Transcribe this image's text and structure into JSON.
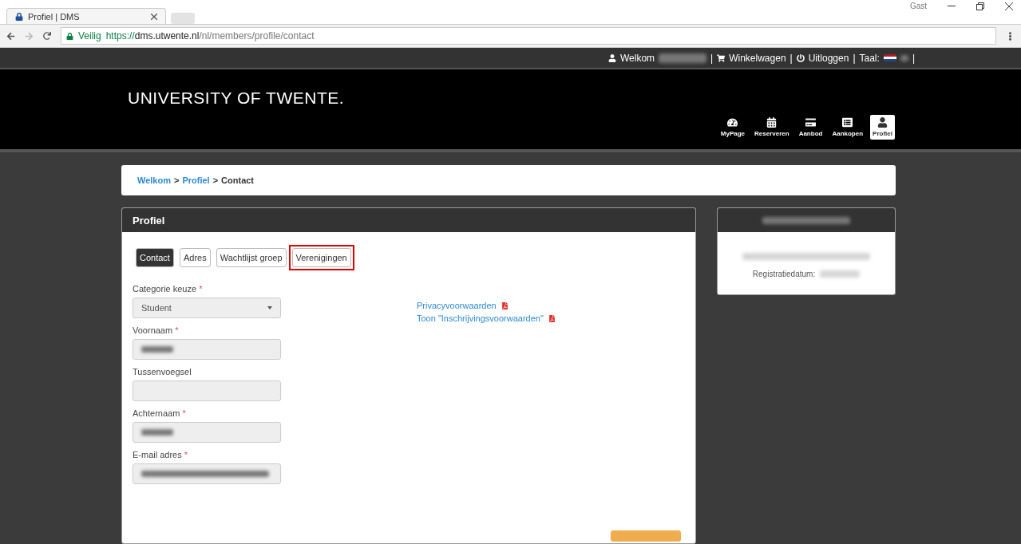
{
  "browser": {
    "tab_title": "Profiel | DMS",
    "window_user": "Gast",
    "secure_label": "Veilig",
    "url_scheme": "https://",
    "url_host": "dms.utwente.nl",
    "url_path": "/nl/members/profile/contact"
  },
  "top_bar": {
    "welcome": "Welkom",
    "cart": "Winkelwagen",
    "logout": "Uitloggen",
    "language_label": "Taal:",
    "separators": [
      "|",
      "|",
      "|",
      "|"
    ]
  },
  "header": {
    "logo": "UNIVERSITY OF TWENTE.",
    "nav": [
      {
        "label": "MyPage",
        "selected": false
      },
      {
        "label": "Reserveren",
        "selected": false
      },
      {
        "label": "Aanbod",
        "selected": false
      },
      {
        "label": "Aankopen",
        "selected": false
      },
      {
        "label": "Profiel",
        "selected": true
      }
    ]
  },
  "breadcrumb": [
    {
      "label": "Welkom",
      "link": true
    },
    {
      "label": ">",
      "link": false
    },
    {
      "label": "Profiel",
      "link": true
    },
    {
      "label": ">",
      "link": false
    },
    {
      "label": "Contact",
      "link": false
    }
  ],
  "panel": {
    "title": "Profiel",
    "tabs": [
      {
        "label": "Contact",
        "selected": true,
        "highlighted": false
      },
      {
        "label": "Adres",
        "selected": false,
        "highlighted": false
      },
      {
        "label": "Wachtlijst groep",
        "selected": false,
        "highlighted": false
      },
      {
        "label": "Verenigingen",
        "selected": false,
        "highlighted": true
      }
    ],
    "fields": [
      {
        "kind": "select",
        "label": "Categorie keuze",
        "required": true,
        "value": "Student"
      },
      {
        "kind": "input",
        "label": "Voornaam",
        "required": true,
        "value_hidden": true
      },
      {
        "kind": "input",
        "label": "Tussenvoegsel",
        "required": false,
        "value_hidden": false
      },
      {
        "kind": "input",
        "label": "Achternaam",
        "required": true,
        "value_hidden": true
      },
      {
        "kind": "input",
        "label": "E-mail adres",
        "required": true,
        "value_hidden": true
      }
    ],
    "required_mark": "*",
    "links": [
      "Privacyvoorwaarden",
      "Toon \"Inschrijvingsvoorwaarden\""
    ]
  },
  "side_card": {
    "registration_label": "Registratiedatum:"
  }
}
